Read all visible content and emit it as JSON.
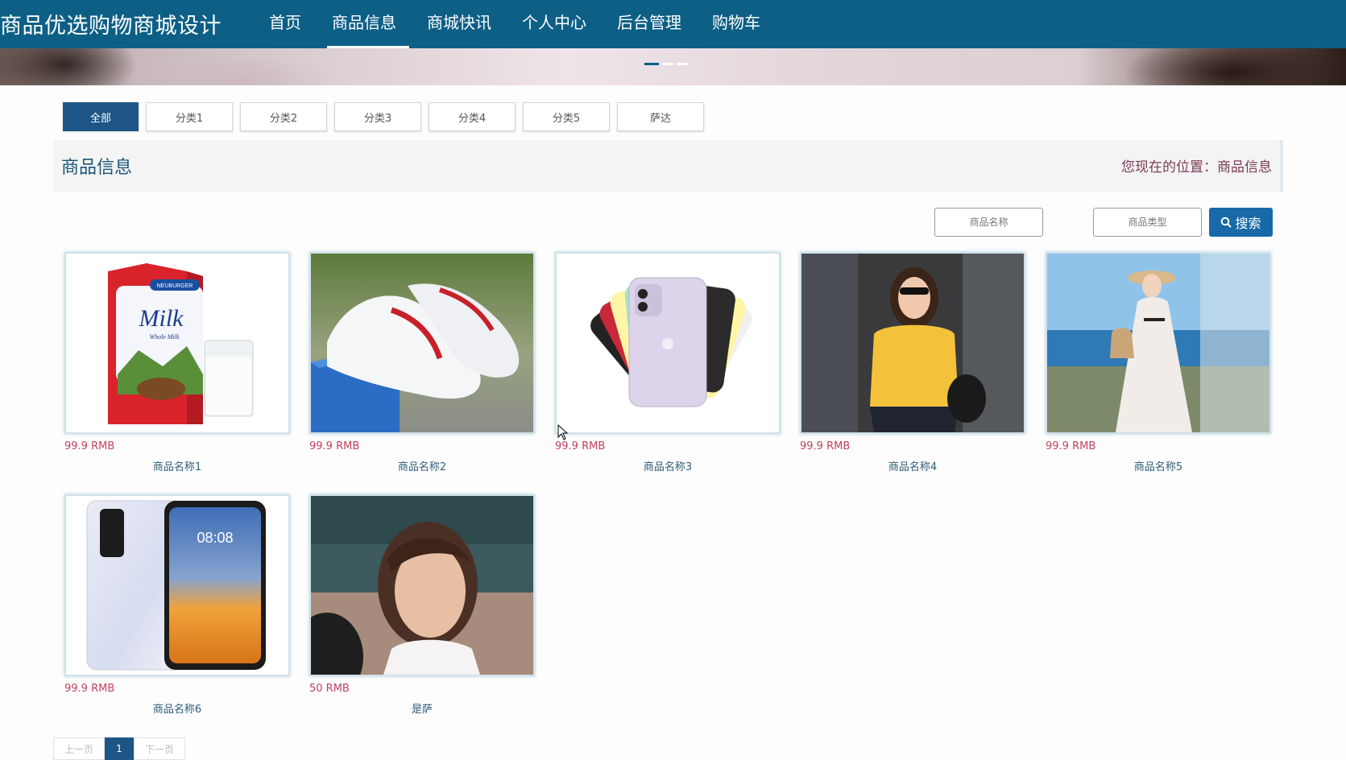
{
  "header": {
    "site_title": "商品优选购物商城设计"
  },
  "nav": {
    "items": [
      {
        "label": "首页"
      },
      {
        "label": "商品信息"
      },
      {
        "label": "商城快讯"
      },
      {
        "label": "个人中心"
      },
      {
        "label": "后台管理"
      },
      {
        "label": "购物车"
      }
    ],
    "active_index": 1
  },
  "banner": {
    "dots": 3,
    "active_dot": 0
  },
  "categories": [
    "全部",
    "分类1",
    "分类2",
    "分类3",
    "分类4",
    "分类5",
    "萨达"
  ],
  "section": {
    "title": "商品信息",
    "breadcrumb": "您现在的位置：商品信息"
  },
  "search": {
    "name_placeholder": "商品名称",
    "type_placeholder": "商品类型",
    "button_label": "搜索"
  },
  "products": [
    {
      "price": "99.9 RMB",
      "name": "商品名称1",
      "image": "milk-carton"
    },
    {
      "price": "99.9 RMB",
      "name": "商品名称2",
      "image": "white-sneakers"
    },
    {
      "price": "99.9 RMB",
      "name": "商品名称3",
      "image": "iphone-colors"
    },
    {
      "price": "99.9 RMB",
      "name": "商品名称4",
      "image": "woman-yellow-sweater"
    },
    {
      "price": "99.9 RMB",
      "name": "商品名称5",
      "image": "woman-white-dress"
    },
    {
      "price": "99.9 RMB",
      "name": "商品名称6",
      "image": "phone-front-back"
    },
    {
      "price": "50 RMB",
      "name": "是萨",
      "image": "woman-portrait"
    }
  ],
  "product_images": {
    "milk_brand": "NEUBURGER",
    "milk_label": "Milk",
    "milk_sub": "Whole Milk",
    "phone_time": "08:08"
  },
  "pagination": {
    "prev": "上一页",
    "current": "1",
    "next": "下一页"
  },
  "colors": {
    "header_bg": "#0d5f86",
    "accent": "#1d5686",
    "price": "#c2415d",
    "search_btn": "#1769a8"
  }
}
